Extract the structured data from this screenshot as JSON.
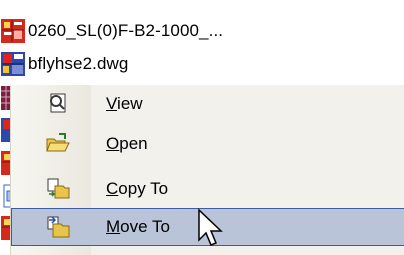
{
  "files": [
    {
      "name": "0260_SL(0)F-B2-1000_...",
      "icon": "cad-file-red-icon"
    },
    {
      "name": "bflyhse2.dwg",
      "icon": "cad-file-blue-icon"
    }
  ],
  "context_menu": {
    "items": [
      {
        "prefix": "",
        "accel": "V",
        "suffix": "iew",
        "icon": "view-icon"
      },
      {
        "prefix": "",
        "accel": "O",
        "suffix": "pen",
        "icon": "open-folder-icon"
      },
      {
        "prefix": "",
        "accel": "C",
        "suffix": "opy To",
        "icon": "copy-to-icon"
      },
      {
        "prefix": "",
        "accel": "M",
        "suffix": "ove To",
        "icon": "move-to-icon",
        "selected": true
      }
    ]
  },
  "colors": {
    "selection_bg": "#b9c4d8",
    "selection_border": "#3a5ca8",
    "menu_bg": "#f2f1ec"
  }
}
